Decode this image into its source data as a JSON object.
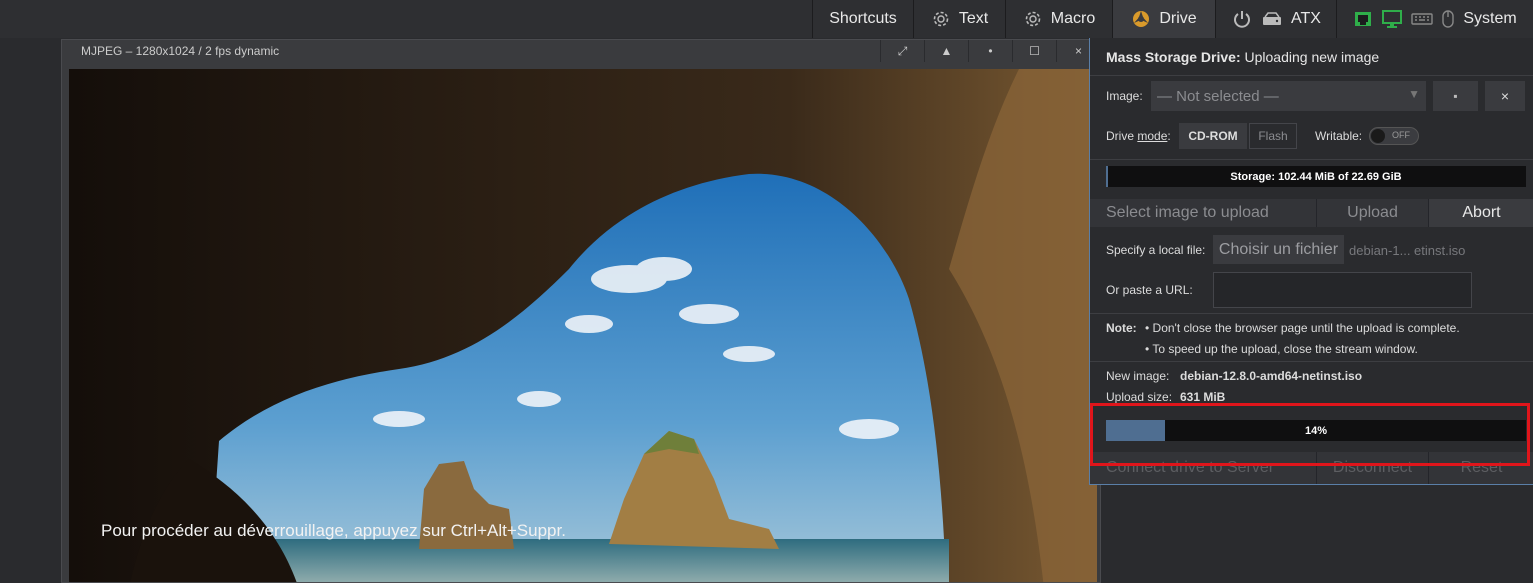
{
  "menu": {
    "shortcuts": "Shortcuts",
    "text": "Text",
    "macro": "Macro",
    "drive": "Drive",
    "atx": "ATX",
    "system": "System"
  },
  "stream": {
    "title": "MJPEG – 1280x1024 / 2 fps dynamic",
    "buttons": [
      "⤢",
      "▲",
      "•",
      "☐",
      "×"
    ],
    "lock_message": "Pour procéder au déverrouillage, appuyez sur Ctrl+Alt+Suppr."
  },
  "drive": {
    "title_bold": "Mass Storage Drive:",
    "title_rest": "Uploading new image",
    "image_label": "Image:",
    "image_value": "— Not selected —",
    "save_icon": "▪",
    "close_icon": "×",
    "mode_label": "Drive mode:",
    "mode_label_prefix": "Drive ",
    "mode_label_link": "mode",
    "mode_label_suffix": ":",
    "mode_cdrom": "CD-ROM",
    "mode_flash": "Flash",
    "writable_label": "Writable:",
    "writable_state": "OFF",
    "storage_text": "Storage: 102.44 MiB of 22.69 GiB",
    "storage_fraction": 0.0044,
    "tab_select": "Select image to upload",
    "tab_upload": "Upload",
    "tab_abort": "Abort",
    "local_file_label": "Specify a local file:",
    "choose_file_button": "Choisir un fichier",
    "chosen_file": "debian-1... etinst.iso",
    "url_label": "Or paste a URL:",
    "note_label": "Note:",
    "note_1": "• Don't close the browser page until the upload is complete.",
    "note_2": "• To speed up the upload, close the stream window.",
    "new_image_label": "New image:",
    "new_image_value": "debian-12.8.0-amd64-netinst.iso",
    "upload_size_label": "Upload size:",
    "upload_size_value": "631 MiB",
    "progress_text": "14%",
    "progress_fraction": 0.14,
    "connect_button": "Connect drive to Server",
    "disconnect_button": "Disconnect",
    "reset_button": "Reset"
  },
  "colors": {
    "accent": "#4f6e91",
    "highlight": "#e0151b",
    "panel_border": "#5a7fa8"
  }
}
